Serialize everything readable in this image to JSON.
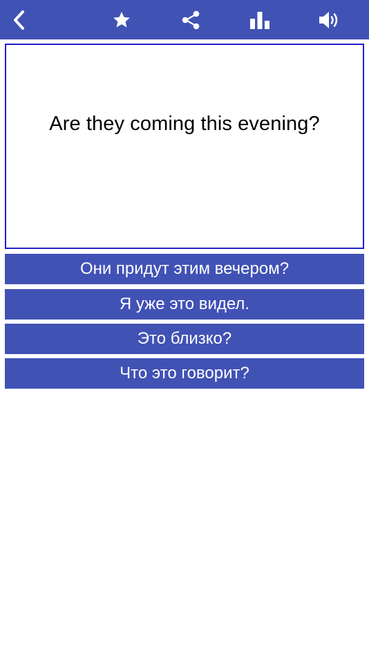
{
  "toolbar": {
    "icons": [
      "back-chevron-icon",
      "star-icon",
      "share-icon",
      "stats-icon",
      "speaker-icon"
    ],
    "color": "#4152b5"
  },
  "question": {
    "text": "Are they coming this evening?",
    "border_color": "#1d1fc9"
  },
  "answers": [
    {
      "label": "Они придут этим вечером?"
    },
    {
      "label": "Я уже это видел."
    },
    {
      "label": "Это близко?"
    },
    {
      "label": "Что это говорит?"
    }
  ],
  "answer_color": "#4152b5"
}
